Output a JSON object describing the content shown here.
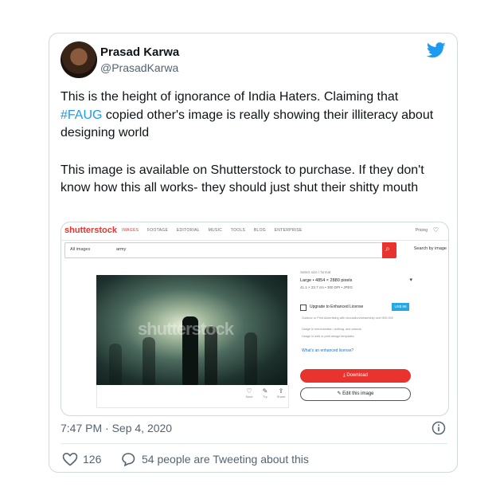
{
  "tweet": {
    "author_name": "Prasad Karwa",
    "handle": "@PrasadKarwa",
    "para1_prefix": "This is the height of ignorance of India Haters. Claiming that ",
    "hashtag": "#FAUG",
    "para1_suffix": " copied other's image is really showing their illiteracy about designing world",
    "para2": "This image is available on Shutterstock to purchase. If they don't know how this all works- they should just shut their shitty mouth",
    "timestamp": "7:47 PM · Sep 4, 2020",
    "like_count": "126",
    "replies_text": "54 people are Tweeting about this"
  },
  "shutterstock": {
    "logo": "shutterstock",
    "nav": [
      "IMAGES",
      "FOOTAGE",
      "EDITORIAL",
      "MUSIC",
      "TOOLS",
      "BLOG",
      "ENTERPRISE"
    ],
    "pricing": "Pricing",
    "all_images": "All images",
    "query": "army",
    "search_by_image": "Search by image",
    "watermark": "shutterstock",
    "size_label": "Select size / format",
    "size": "Large • 4854 × 2880 pixels",
    "dims": "41.1 × 23.7 cm • 300 DPI • JPEG",
    "upgrade": "Upgrade to Enhanced License",
    "price": "US$ 99",
    "bullets": [
      "Outdoor or Print Advertising with circulation/viewership over 500,000",
      "Usage in merchandise, clothing, and artwork",
      "Usage in web or print design templates"
    ],
    "enhanced_link": "What's an enhanced license?",
    "download": "Download",
    "edit": "Edit this image",
    "actions": [
      "Save",
      "Try",
      "Share"
    ]
  },
  "colors": {
    "link_blue": "#1d9bf0",
    "twitter_blue": "#1d9bf0",
    "ss_red": "#e8332f",
    "muted": "#536471"
  }
}
